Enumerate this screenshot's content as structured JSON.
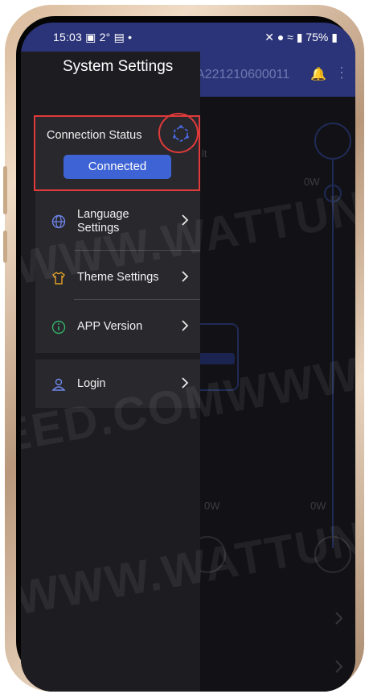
{
  "status_bar": {
    "time": "15:03",
    "temperature": "2°",
    "battery": "75%"
  },
  "app_bar": {
    "device_id": "A221210600011"
  },
  "drawer": {
    "title": "System Settings",
    "connection": {
      "label": "Connection Status",
      "button_label": "Connected"
    },
    "items": [
      {
        "label": "Language Settings",
        "icon": "globe-icon"
      },
      {
        "label": "Theme Settings",
        "icon": "shirt-icon"
      },
      {
        "label": "APP Version",
        "icon": "info-icon"
      },
      {
        "label": "Login",
        "icon": "user-icon"
      }
    ]
  },
  "background": {
    "power_top": "0W",
    "power_left": "0W",
    "power_right": "0W",
    "partial_text": "lt"
  },
  "watermark": {
    "lines": [
      "WWW.WATTUNE",
      "EED.COMWWW.",
      "WWW.WATTUNE"
    ]
  },
  "colors": {
    "accent": "#3e63d4",
    "header": "#2b3478",
    "highlight": "#e03a3a"
  }
}
